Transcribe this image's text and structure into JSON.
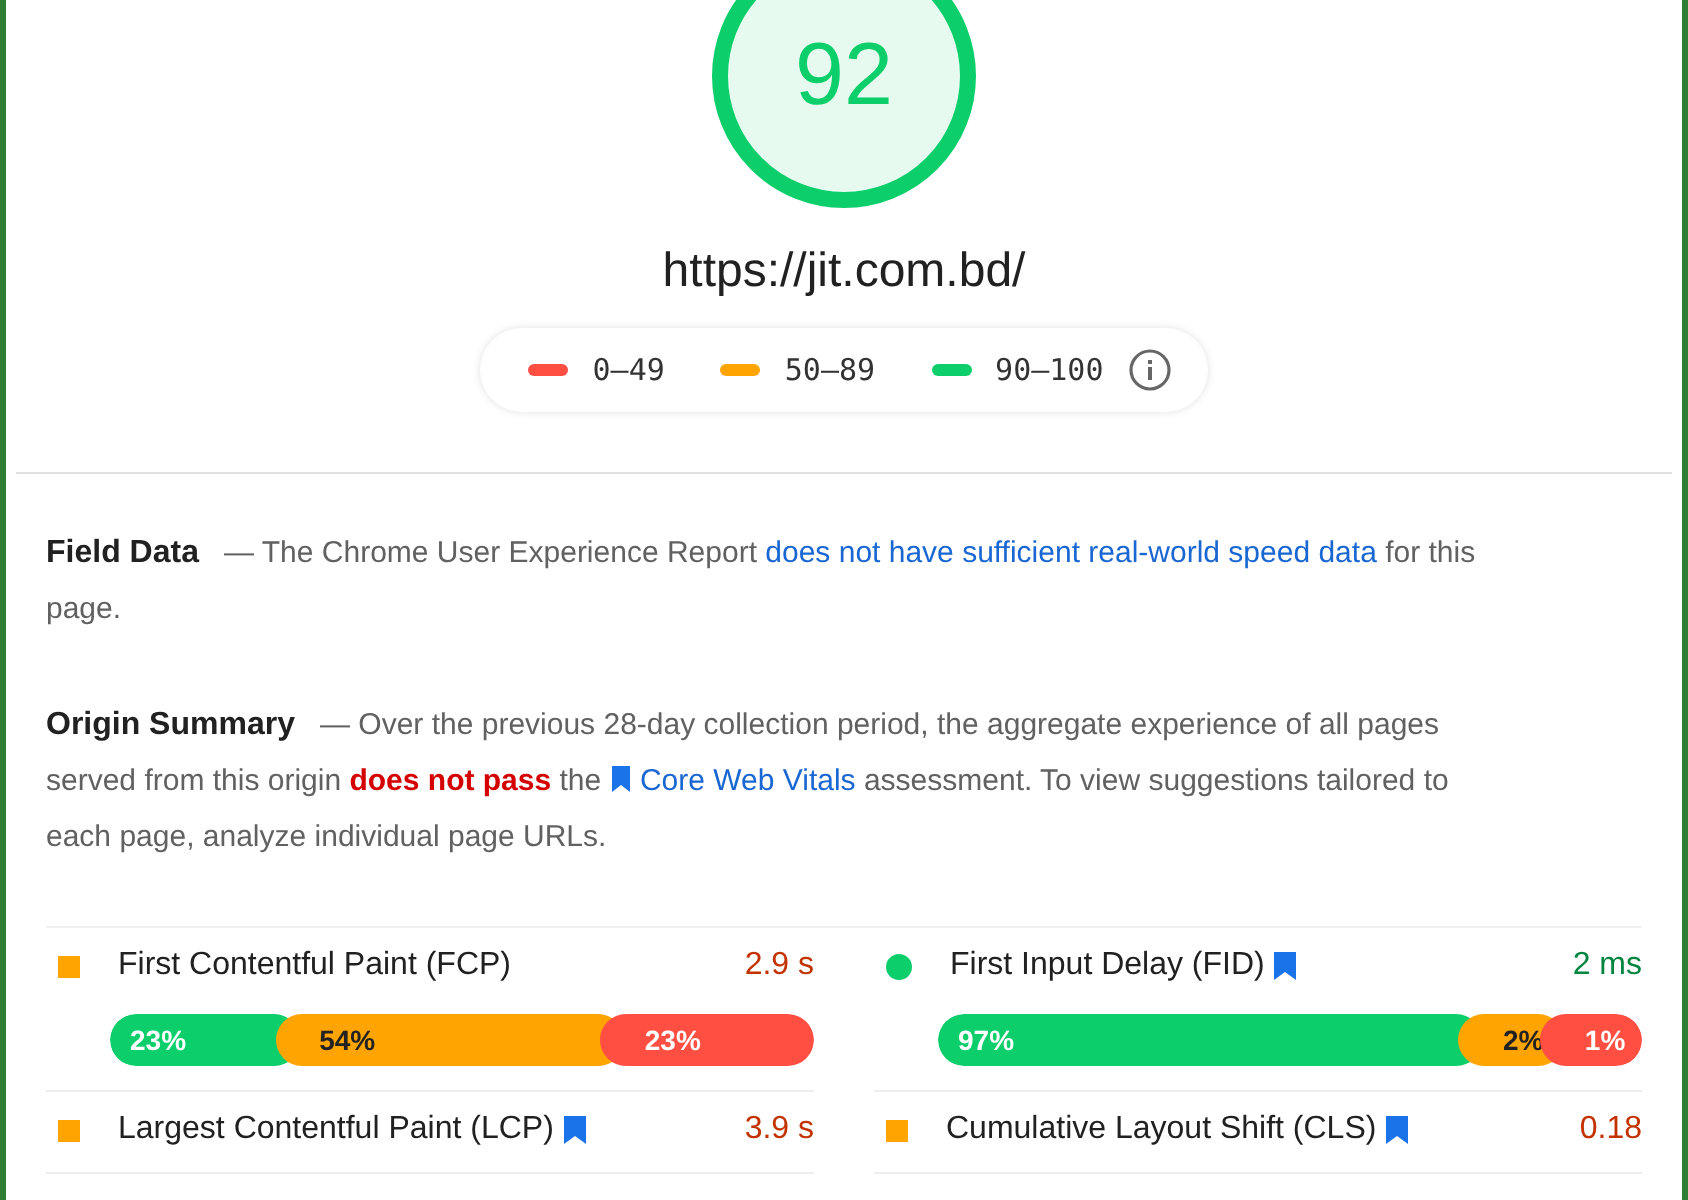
{
  "score": {
    "value": "92",
    "color": "#0cce6b"
  },
  "url": "https://jit.com.bd/",
  "legend": [
    {
      "label": "0–49",
      "color": "#ff4e42"
    },
    {
      "label": "50–89",
      "color": "#ffa400"
    },
    {
      "label": "90–100",
      "color": "#0cce6b"
    }
  ],
  "field_data": {
    "title": "Field Data",
    "parts": [
      {
        "kind": "text",
        "text": "— The Chrome User Experience Report "
      },
      {
        "kind": "link",
        "text": "does not have sufficient real-world speed data"
      },
      {
        "kind": "text",
        "text": " for this page."
      }
    ]
  },
  "origin_summary": {
    "title": "Origin Summary",
    "parts": [
      {
        "kind": "text",
        "text": "— Over the previous 28-day collection period, the aggregate experience of all pages served from this origin "
      },
      {
        "kind": "fail",
        "text": "does not pass"
      },
      {
        "kind": "text",
        "text": " the "
      },
      {
        "kind": "bookmark-link",
        "text": "Core Web Vitals"
      },
      {
        "kind": "text",
        "text": " assessment. To view suggestions tailored to each page, analyze individual page URLs."
      }
    ]
  },
  "metrics": [
    {
      "name": "First Contentful Paint (FCP)",
      "color": "#ffa400",
      "value": "2.9 s",
      "distribution": [
        {
          "label": "23%",
          "color": "#0cce6b"
        },
        {
          "label": "54%",
          "color": "#ffa400"
        },
        {
          "label": "23%",
          "color": "#ff4e42"
        }
      ]
    },
    {
      "name": "First Input Delay (FID)",
      "color": "#0cce6b",
      "core": true,
      "value": "2 ms",
      "distribution": [
        {
          "label": "97%",
          "color": "#0cce6b"
        },
        {
          "label": "2%",
          "color": "#ffa400"
        },
        {
          "label": "1%",
          "color": "#ff4e42"
        }
      ]
    },
    {
      "name": "Largest Contentful Paint (LCP)",
      "color": "#ffa400",
      "core": true,
      "value": "3.9 s"
    },
    {
      "name": "Cumulative Layout Shift (CLS)",
      "color": "#ffa400",
      "core": true,
      "value": "0.18"
    }
  ]
}
